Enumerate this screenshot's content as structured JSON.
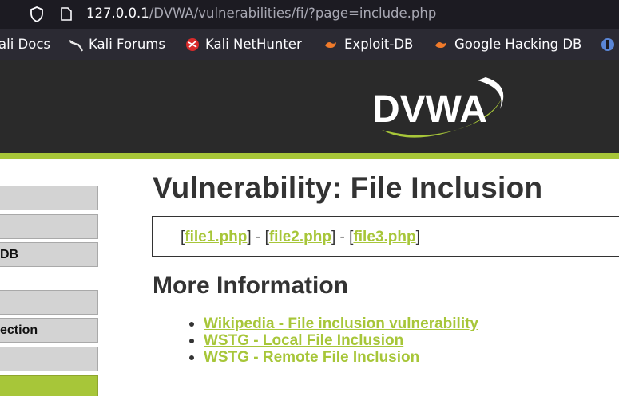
{
  "browser": {
    "url_host": "127.0.0.1",
    "url_path": "/DVWA/vulnerabilities/fi/?page=include.php"
  },
  "bookmarks": [
    {
      "label": "ali Docs",
      "icon": "kali-docs-icon"
    },
    {
      "label": "Kali Forums",
      "icon": "kali-dragon-icon"
    },
    {
      "label": "Kali NetHunter",
      "icon": "nethunter-icon"
    },
    {
      "label": "Exploit-DB",
      "icon": "exploit-db-icon"
    },
    {
      "label": "Google Hacking DB",
      "icon": "ghdb-icon"
    }
  ],
  "header": {
    "logo_text": "DVWA"
  },
  "sidebar": {
    "items": [
      {
        "label": "",
        "selected": false
      },
      {
        "label": "",
        "selected": false
      },
      {
        "label": "DB",
        "selected": false
      },
      {
        "label": "",
        "selected": false
      },
      {
        "label": "ection",
        "selected": false
      },
      {
        "label": "",
        "selected": false
      },
      {
        "label": "",
        "selected": true
      }
    ]
  },
  "main": {
    "title": "Vulnerability: File Inclusion",
    "file_links": {
      "file1": "file1.php",
      "file2": "file2.php",
      "file3": "file3.php",
      "open": "[",
      "close": "]",
      "sep": " - "
    },
    "more_info_title": "More Information",
    "more_info_links": [
      "Wikipedia - File inclusion vulnerability",
      "WSTG - Local File Inclusion",
      "WSTG - Remote File Inclusion"
    ]
  },
  "colors": {
    "accent": "#a7c639",
    "header_bg": "#2a2a2a",
    "text": "#333333"
  }
}
